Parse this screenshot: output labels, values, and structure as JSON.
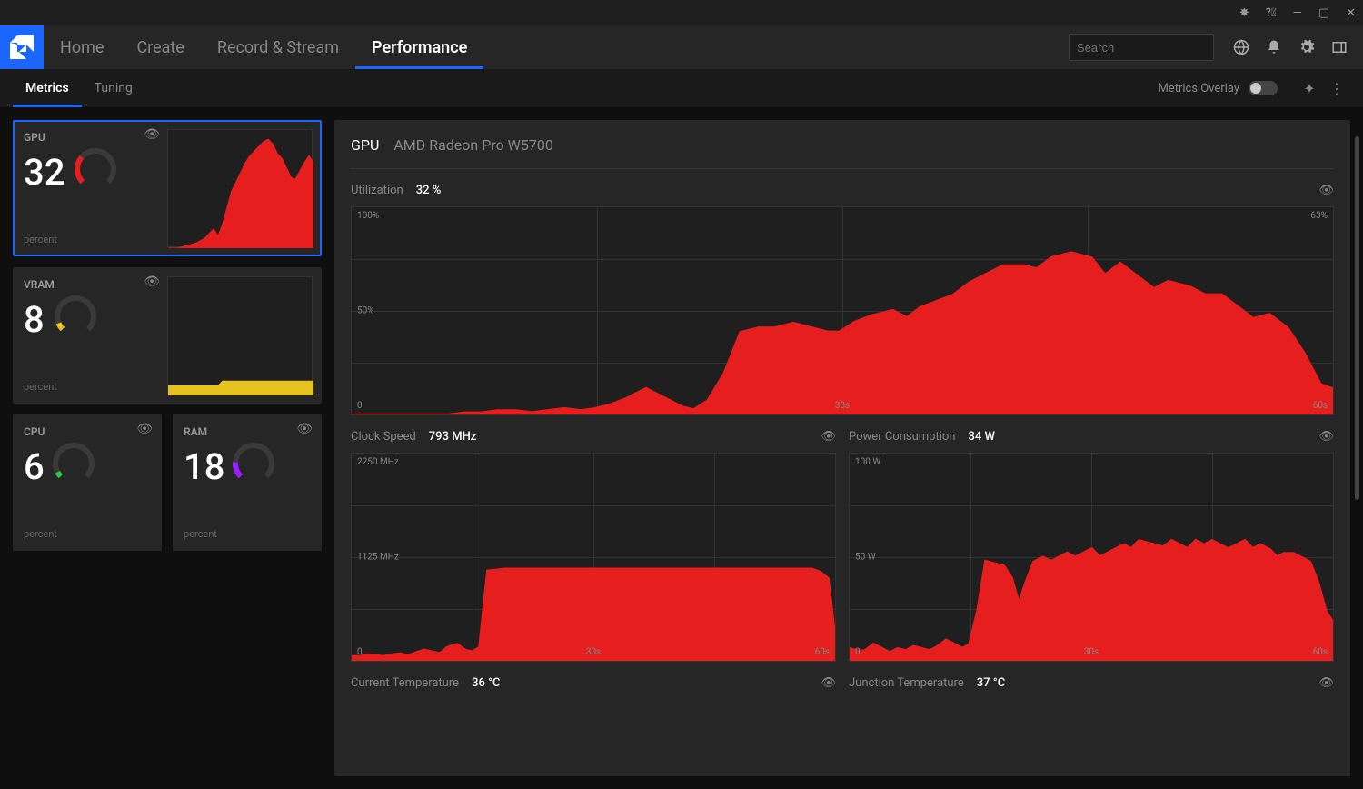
{
  "nav": {
    "home": "Home",
    "create": "Create",
    "record": "Record & Stream",
    "performance": "Performance"
  },
  "search": {
    "placeholder": "Search"
  },
  "subtabs": {
    "metrics": "Metrics",
    "tuning": "Tuning",
    "overlay": "Metrics Overlay"
  },
  "cards": {
    "gpu": {
      "title": "GPU",
      "value": "32",
      "unit": "percent"
    },
    "vram": {
      "title": "VRAM",
      "value": "8",
      "unit": "percent"
    },
    "cpu": {
      "title": "CPU",
      "value": "6",
      "unit": "percent"
    },
    "ram": {
      "title": "RAM",
      "value": "18",
      "unit": "percent"
    }
  },
  "detail": {
    "title": "GPU",
    "subtitle": "AMD Radeon Pro W5700",
    "util": {
      "label": "Utilization",
      "value": "32 %",
      "top_left": "100%",
      "top_right": "63%",
      "mid": "50%",
      "bot_left": "0",
      "bot_center": "30s",
      "bot_right": "60s"
    },
    "clock": {
      "label": "Clock Speed",
      "value": "793 MHz",
      "top_left": "2250 MHz",
      "mid": "1125 MHz",
      "bot_left": "0",
      "bot_center": "30s",
      "bot_right": "60s"
    },
    "power": {
      "label": "Power Consumption",
      "value": "34 W",
      "top_left": "100 W",
      "mid": "50 W",
      "bot_left": "0",
      "bot_center": "30s",
      "bot_right": "60s"
    },
    "temp": {
      "label": "Current Temperature",
      "value": "36 °C"
    },
    "jtemp": {
      "label": "Junction Temperature",
      "value": "37 °C"
    }
  },
  "chart_data": {
    "utilization": {
      "type": "area",
      "ylim": [
        0,
        100
      ],
      "xlim": [
        0,
        60
      ],
      "title": "Utilization",
      "ylabel": "%",
      "current": 63,
      "values": [
        0,
        0,
        0,
        0,
        0,
        0,
        0,
        1,
        1,
        2,
        2,
        1,
        2,
        3,
        2,
        3,
        5,
        8,
        12,
        8,
        4,
        2,
        7,
        20,
        40,
        42,
        42,
        44,
        42,
        40,
        40,
        45,
        48,
        50,
        46,
        52,
        55,
        58,
        64,
        68,
        72,
        72,
        70,
        76,
        78,
        76,
        66,
        72,
        66,
        60,
        64,
        62,
        58,
        58,
        52,
        46,
        48,
        42,
        30,
        15,
        12
      ]
    },
    "clock": {
      "type": "area",
      "ylim": [
        0,
        2250
      ],
      "xlim": [
        0,
        60
      ],
      "title": "Clock Speed",
      "ylabel": "MHz",
      "current": 793,
      "values": [
        50,
        50,
        70,
        60,
        50,
        70,
        80,
        60,
        90,
        120,
        100,
        80,
        150,
        180,
        120,
        100,
        150,
        980,
        990,
        1000,
        1000,
        1000,
        1000,
        1000,
        1000,
        1000,
        1000,
        1000,
        1000,
        1000,
        1000,
        1000,
        1000,
        1000,
        1000,
        1000,
        1000,
        1000,
        1000,
        1000,
        1000,
        1000,
        1000,
        1000,
        1000,
        1000,
        1000,
        1000,
        1000,
        1000,
        1000,
        1000,
        1000,
        1000,
        1000,
        1000,
        1000,
        1000,
        970,
        900,
        150
      ]
    },
    "power": {
      "type": "area",
      "ylim": [
        0,
        100
      ],
      "xlim": [
        0,
        60
      ],
      "title": "Power Consumption",
      "ylabel": "W",
      "current": 34,
      "values": [
        6,
        5,
        5,
        8,
        6,
        4,
        6,
        5,
        7,
        6,
        5,
        7,
        10,
        8,
        6,
        8,
        24,
        48,
        47,
        46,
        40,
        26,
        38,
        48,
        50,
        48,
        50,
        52,
        50,
        52,
        54,
        50,
        52,
        54,
        56,
        54,
        58,
        57,
        56,
        55,
        58,
        56,
        54,
        58,
        56,
        58,
        56,
        54,
        56,
        58,
        54,
        56,
        54,
        50,
        52,
        52,
        50,
        48,
        38,
        24,
        18
      ]
    },
    "gpu_spark": {
      "type": "area",
      "ylim": [
        0,
        100
      ],
      "values": [
        0,
        0,
        0,
        1,
        2,
        3,
        4,
        6,
        8,
        12,
        16,
        10,
        20,
        34,
        48,
        56,
        64,
        72,
        78,
        82,
        86,
        90,
        92,
        88,
        80,
        76,
        68,
        60,
        58,
        65,
        72,
        78,
        72
      ]
    },
    "vram_spark": {
      "type": "area",
      "ylim": [
        0,
        100
      ],
      "values": [
        8,
        8,
        8,
        8,
        8,
        8,
        8,
        8,
        8,
        8,
        8,
        8,
        12,
        12,
        12,
        12,
        12,
        12,
        12,
        12,
        12,
        12,
        12,
        12,
        12,
        12,
        12,
        12,
        12,
        12,
        12,
        12,
        12
      ]
    }
  }
}
